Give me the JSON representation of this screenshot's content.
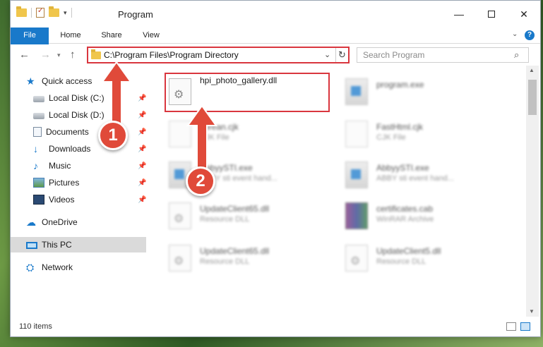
{
  "window": {
    "title": "Program",
    "min_glyph": "—",
    "close_glyph": "✕"
  },
  "qat": {
    "dropdown_glyph": "▾"
  },
  "ribbon": {
    "tabs": [
      {
        "label": "File"
      },
      {
        "label": "Home"
      },
      {
        "label": "Share"
      },
      {
        "label": "View"
      }
    ],
    "help_glyph": "?",
    "caret_glyph": "⌄"
  },
  "nav": {
    "back_glyph": "←",
    "forward_glyph": "→",
    "recent_glyph": "▾",
    "up_glyph": "↑"
  },
  "address": {
    "path": "C:\\Program Files\\Program Directory",
    "dropdown_glyph": "⌄",
    "refresh_glyph": "↻"
  },
  "search": {
    "placeholder": "Search Program",
    "icon_glyph": "⌕"
  },
  "navpane": {
    "quick_access": "Quick access",
    "local_disk_c": "Local Disk (C:)",
    "local_disk_d": "Local Disk (D:)",
    "documents": "Documents",
    "downloads": "Downloads",
    "music": "Music",
    "pictures": "Pictures",
    "videos": "Videos",
    "onedrive": "OneDrive",
    "this_pc": "This PC",
    "network": "Network",
    "pin_glyph": "📌"
  },
  "files": [
    {
      "name": "hpi_photo_gallery.dll",
      "type": ""
    },
    {
      "name": "program.exe",
      "type": ""
    },
    {
      "name": "korean.cjk",
      "type": "CJK File"
    },
    {
      "name": "FastHtml.cjk",
      "type": "CJK File"
    },
    {
      "name": "AbbyySTI.exe",
      "type": "ABBY sti event hand..."
    },
    {
      "name": "AbbyySTI.exe",
      "type": "ABBY sti event hand..."
    },
    {
      "name": "UpdateClient65.dll",
      "type": "Resource DLL"
    },
    {
      "name": "certificates.cab",
      "type": "WinRAR Archive"
    },
    {
      "name": "UpdateClient65.dll",
      "type": "Resource DLL"
    },
    {
      "name": "UpdateClient5.dll",
      "type": "Resource DLL"
    }
  ],
  "status": {
    "count": "110 items"
  },
  "annotations": {
    "step1": "1",
    "step2": "2",
    "color": "#e04a3a"
  }
}
